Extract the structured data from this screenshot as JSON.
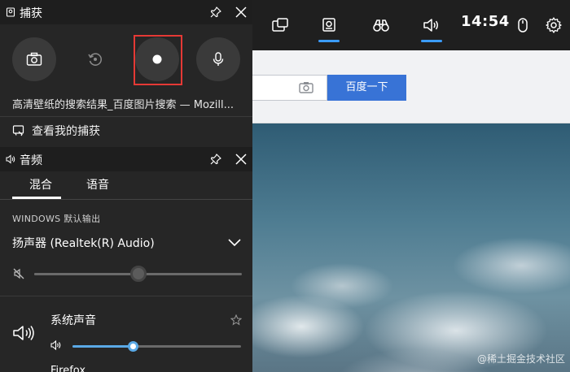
{
  "background": {
    "search_button": "百度一下",
    "watermark": "@稀土掘金技术社区"
  },
  "topbar": {
    "time": "14:54",
    "buttons": [
      {
        "icon": "widget-menu-icon",
        "active": false
      },
      {
        "icon": "capture-icon",
        "active": true
      },
      {
        "icon": "binoculars-icon",
        "active": false
      },
      {
        "icon": "audio-icon",
        "active": true
      },
      {
        "icon": "mouse-icon",
        "active": false
      },
      {
        "icon": "gear-icon",
        "active": false
      }
    ],
    "accent": "#3b9cff"
  },
  "capture": {
    "title": "捕获",
    "caption": "高清壁纸的搜索结果_百度图片搜索 — Mozill...",
    "link": "查看我的捕获",
    "highlight_color": "#e53935"
  },
  "audio": {
    "title": "音频",
    "tabs": [
      {
        "label": "混合",
        "active": true
      },
      {
        "label": "语音",
        "active": false
      }
    ],
    "section_label": "WINDOWS 默认输出",
    "device": "扬声器 (Realtek(R) Audio)",
    "master_volume": 0.5,
    "master_muted": true,
    "app": {
      "name": "系统声音",
      "volume": 0.36,
      "next_app": "Firefox"
    },
    "slider_accent": "#5aa9e6"
  }
}
